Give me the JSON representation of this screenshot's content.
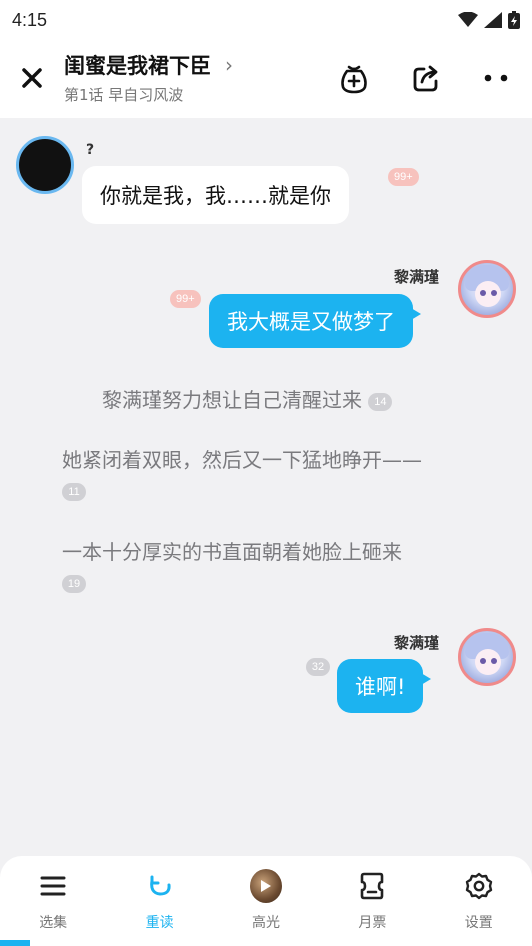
{
  "status": {
    "time": "4:15"
  },
  "header": {
    "title": "闺蜜是我裙下臣",
    "subtitle": "第1话 早自习风波"
  },
  "messages": {
    "left": {
      "name": "?",
      "text": "你就是我，我……就是你",
      "badge": "99+"
    },
    "right1": {
      "name": "黎满瑾",
      "text": "我大概是又做梦了",
      "badge": "99+"
    },
    "narr1": {
      "text": "黎满瑾努力想让自己清醒过来",
      "badge": "14"
    },
    "narr2": {
      "text": "她紧闭着双眼，然后又一下猛地睁开——",
      "badge": "11"
    },
    "narr3": {
      "text": "一本十分厚实的书直面朝着她脸上砸来",
      "badge": "19"
    },
    "right2": {
      "name": "黎满瑾",
      "text": "谁啊!",
      "badge": "32"
    }
  },
  "nav": {
    "items": [
      {
        "label": "选集",
        "icon": "menu-icon"
      },
      {
        "label": "重读",
        "icon": "replay-icon"
      },
      {
        "label": "高光",
        "icon": "highlight-thumb-icon"
      },
      {
        "label": "月票",
        "icon": "ticket-icon"
      },
      {
        "label": "设置",
        "icon": "gear-icon"
      }
    ],
    "active_index": 1
  },
  "colors": {
    "accent": "#1cb3f0",
    "bubble_badge": "#f7c2bd",
    "background": "#f1f1f3"
  }
}
